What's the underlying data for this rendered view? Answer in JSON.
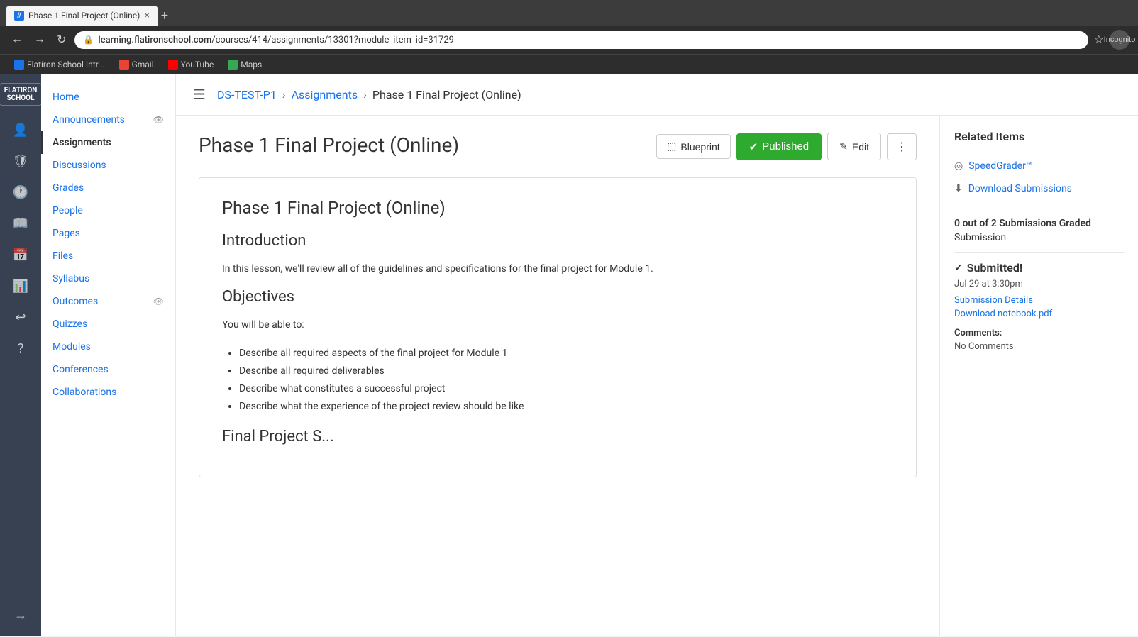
{
  "browser": {
    "tab": {
      "favicon_text": "//",
      "title": "Phase 1 Final Project (Online)",
      "close_label": "×"
    },
    "new_tab_label": "+",
    "toolbar": {
      "back_label": "←",
      "forward_label": "→",
      "refresh_label": "↻",
      "url": "learning.flatironschool.com/courses/414/assignments/13301?module_item_id=31729",
      "url_domain": "learning.flatironschool.com",
      "url_path": "/courses/414/assignments/13301?module_item_id=31729",
      "incognito_label": "Incognito"
    },
    "bookmarks": [
      {
        "name": "Flatiron School Intr...",
        "type": "flatiron"
      },
      {
        "name": "Gmail",
        "type": "gmail"
      },
      {
        "name": "YouTube",
        "type": "youtube"
      },
      {
        "name": "Maps",
        "type": "maps"
      }
    ]
  },
  "rail": {
    "logo_line1": "FLATIRON",
    "logo_line2": "SCHOOL",
    "icons": [
      {
        "name": "user-icon",
        "glyph": "👤"
      },
      {
        "name": "shield-icon",
        "glyph": "🛡"
      },
      {
        "name": "clock-icon",
        "glyph": "🕐"
      },
      {
        "name": "book-icon",
        "glyph": "📖"
      },
      {
        "name": "calendar-icon",
        "glyph": "📅"
      },
      {
        "name": "chart-icon",
        "glyph": "📊"
      },
      {
        "name": "refresh-icon",
        "glyph": "↩"
      },
      {
        "name": "help-icon",
        "glyph": "?"
      },
      {
        "name": "expand-icon",
        "glyph": "→"
      }
    ]
  },
  "breadcrumb": {
    "course": "DS-TEST-P1",
    "section": "Assignments",
    "current": "Phase 1 Final Project (Online)"
  },
  "sidebar": {
    "items": [
      {
        "label": "Home",
        "active": false
      },
      {
        "label": "Announcements",
        "active": false,
        "has_icon": true
      },
      {
        "label": "Assignments",
        "active": true
      },
      {
        "label": "Discussions",
        "active": false
      },
      {
        "label": "Grades",
        "active": false
      },
      {
        "label": "People",
        "active": false
      },
      {
        "label": "Pages",
        "active": false
      },
      {
        "label": "Files",
        "active": false
      },
      {
        "label": "Syllabus",
        "active": false
      },
      {
        "label": "Outcomes",
        "active": false,
        "has_icon": true
      },
      {
        "label": "Quizzes",
        "active": false
      },
      {
        "label": "Modules",
        "active": false
      },
      {
        "label": "Conferences",
        "active": false
      },
      {
        "label": "Collaborations",
        "active": false
      }
    ]
  },
  "assignment": {
    "title": "Phase 1 Final Project (Online)",
    "blueprint_label": "Blueprint",
    "published_label": "Published",
    "edit_label": "Edit",
    "more_label": "⋮",
    "content": {
      "heading": "Phase 1 Final Project (Online)",
      "intro_heading": "Introduction",
      "intro_text": "In this lesson, we'll review all of the guidelines and specifications for the final project for Module 1.",
      "objectives_heading": "Objectives",
      "objectives_sub": "You will be able to:",
      "objectives_list": [
        "Describe all required aspects of the final project for Module 1",
        "Describe all required deliverables",
        "Describe what constitutes a successful project",
        "Describe what the experience of the project review should be like"
      ],
      "final_project_heading": "Final Project S..."
    }
  },
  "right_sidebar": {
    "title": "Related Items",
    "items": [
      {
        "name": "speedgrader-link",
        "label": "SpeedGrader™",
        "icon": "◎"
      },
      {
        "name": "download-submissions-link",
        "label": "Download Submissions",
        "icon": "⬇"
      }
    ],
    "submissions_graded": "0 out of 2 Submissions Graded",
    "submission_label": "Submission",
    "submitted_label": "Submitted!",
    "submitted_date": "Jul 29 at 3:30pm",
    "submission_details_label": "Submission Details",
    "download_notebook_label": "Download notebook.pdf",
    "comments_label": "Comments:",
    "no_comments_label": "No Comments"
  }
}
